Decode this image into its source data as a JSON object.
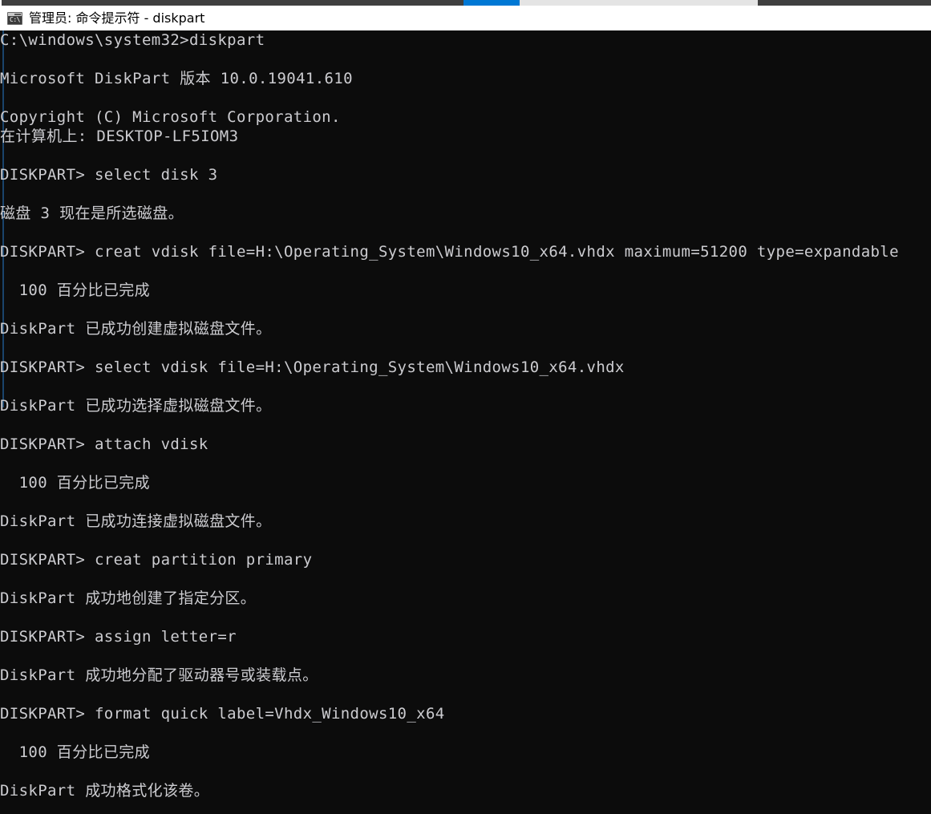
{
  "window": {
    "title": "管理员: 命令提示符 - diskpart",
    "icon_name": "cmd-prompt-icon",
    "icon_glyph": "C:\\",
    "background_color": "#0c0c0c",
    "titlebar_color": "#ffffff",
    "text_color": "#ccccd0",
    "accent_color": "#0078d4"
  },
  "top_strip": {
    "dark_color": "#3f3f3f",
    "blue_color": "#0078d4",
    "gray_color": "#e4e4e4"
  },
  "console": {
    "lines": [
      "C:\\windows\\system32>diskpart",
      "",
      "Microsoft DiskPart 版本 10.0.19041.610",
      "",
      "Copyright (C) Microsoft Corporation.",
      "在计算机上: DESKTOP-LF5IOM3",
      "",
      "DISKPART> select disk 3",
      "",
      "磁盘 3 现在是所选磁盘。",
      "",
      "DISKPART> creat vdisk file=H:\\Operating_System\\Windows10_x64.vhdx maximum=51200 type=expandable",
      "",
      "  100 百分比已完成",
      "",
      "DiskPart 已成功创建虚拟磁盘文件。",
      "",
      "DISKPART> select vdisk file=H:\\Operating_System\\Windows10_x64.vhdx",
      "",
      "DiskPart 已成功选择虚拟磁盘文件。",
      "",
      "DISKPART> attach vdisk",
      "",
      "  100 百分比已完成",
      "",
      "DiskPart 已成功连接虚拟磁盘文件。",
      "",
      "DISKPART> creat partition primary",
      "",
      "DiskPart 成功地创建了指定分区。",
      "",
      "DISKPART> assign letter=r",
      "",
      "DiskPart 成功地分配了驱动器号或装载点。",
      "",
      "DISKPART> format quick label=Vhdx_Windows10_x64",
      "",
      "  100 百分比已完成",
      "",
      "DiskPart 成功格式化该卷。"
    ]
  }
}
